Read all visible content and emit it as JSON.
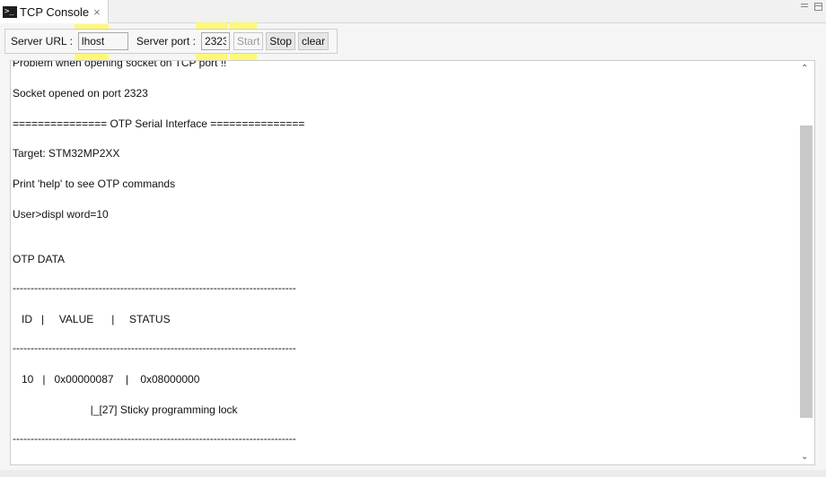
{
  "tab": {
    "icon": "terminal-icon",
    "title": "TCP Console",
    "close_glyph": "×"
  },
  "window_controls": [
    "minimize-icon",
    "maximize-icon"
  ],
  "toolbar": {
    "url_label": "Server URL :",
    "url_value": "lhost",
    "port_label": "Server port :",
    "port_value": "2323",
    "start_label": "Start",
    "stop_label": "Stop",
    "clear_label": "clear"
  },
  "console": {
    "lines": [
      "Problem when opening socket on TCP port !!",
      "Socket opened on port 2323",
      "=============== OTP Serial Interface ===============",
      "Target: STM32MP2XX",
      "Print 'help' to see OTP commands",
      "User>displ word=10",
      "OTP DATA",
      "-------------------------------------------------------------------------------",
      "   ID   |     VALUE      |     STATUS",
      "-------------------------------------------------------------------------------",
      "   10   |   0x00000087    |    0x08000000",
      "                          |_[27] Sticky programming lock",
      "-------------------------------------------------------------------------------"
    ]
  },
  "highlight_color": "#fff96a"
}
